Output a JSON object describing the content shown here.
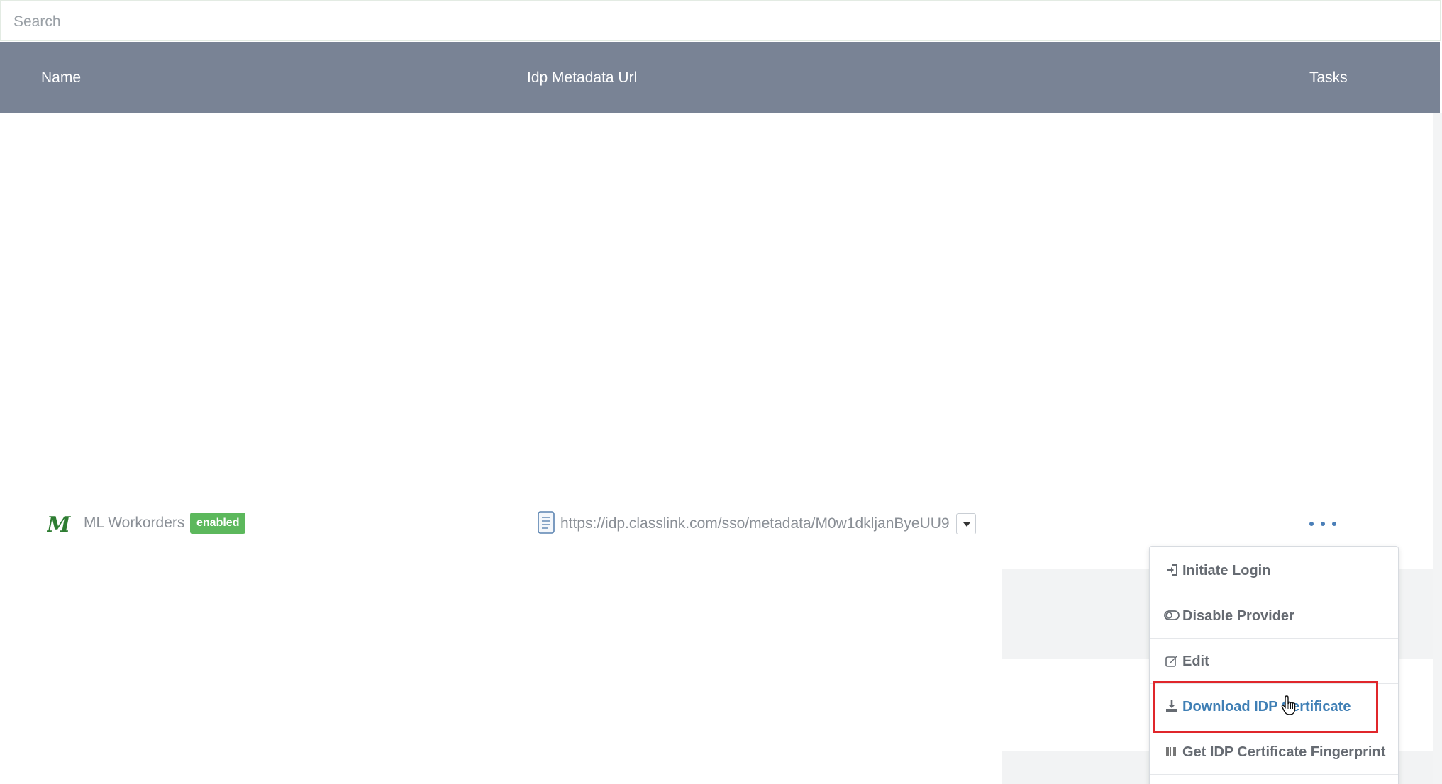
{
  "search": {
    "placeholder": "Search"
  },
  "table": {
    "columns": {
      "name": "Name",
      "url": "Idp Metadata Url",
      "tasks": "Tasks"
    },
    "rows": [
      {
        "logo_text": "M",
        "name": "ML Workorders",
        "status": "enabled",
        "metadata_url": "https://idp.classlink.com/sso/metadata/M0w1dkljanByeUU9"
      }
    ]
  },
  "tasks_menu": {
    "items": [
      {
        "label": "Initiate Login",
        "icon": "sign-in-icon"
      },
      {
        "label": "Disable Provider",
        "icon": "toggle-off-icon"
      },
      {
        "label": "Edit",
        "icon": "edit-icon"
      },
      {
        "label": "Download IDP Certificate",
        "icon": "download-icon"
      },
      {
        "label": "Get IDP Certificate Fingerprint",
        "icon": "barcode-icon"
      }
    ]
  },
  "colors": {
    "header_bg": "#798395",
    "badge_bg": "#5cb85c",
    "link": "#3f7fb5",
    "highlight_border": "#e0262b",
    "logo_green": "#2e7d32"
  }
}
